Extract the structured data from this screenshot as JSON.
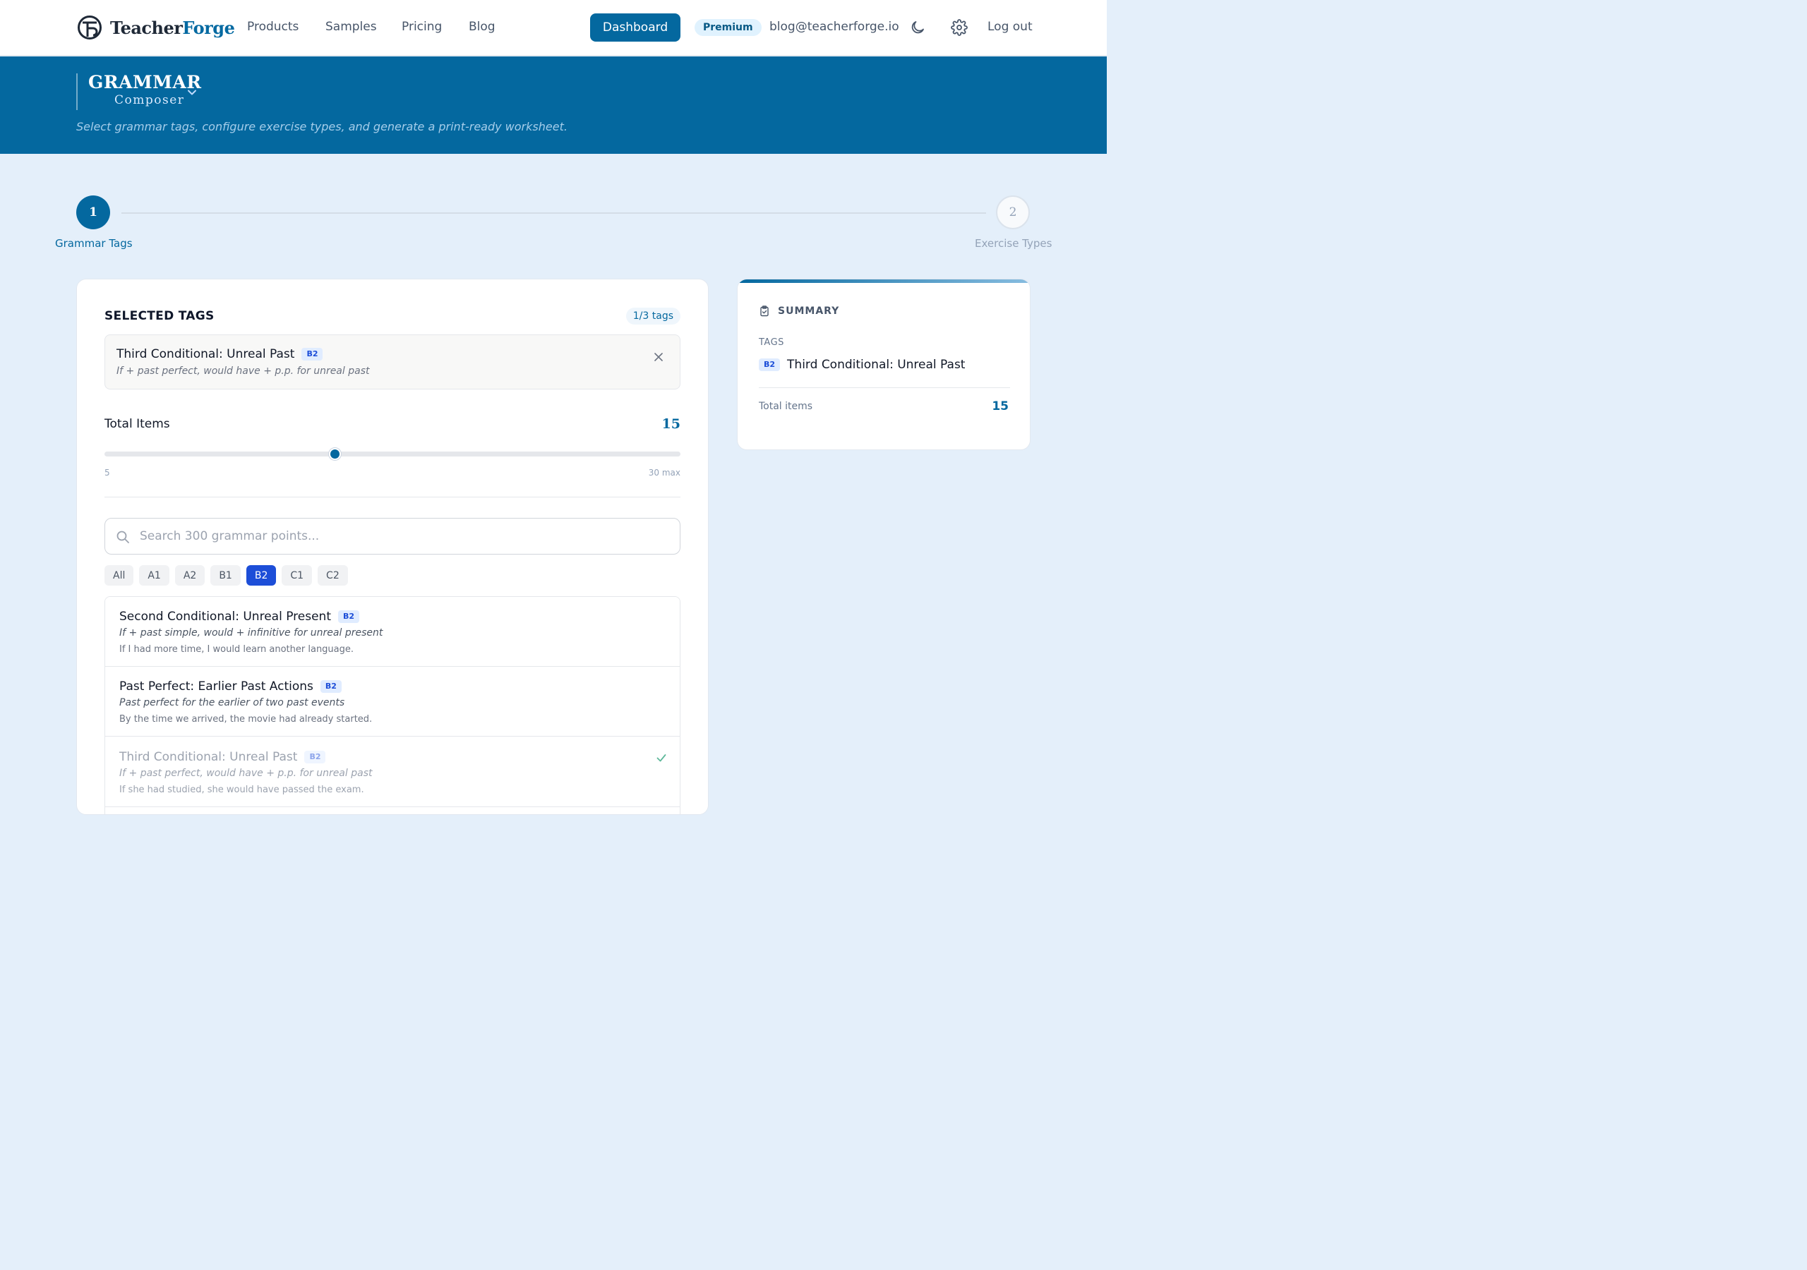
{
  "nav": {
    "brand_part1": "Teacher",
    "brand_part2": "Forge",
    "links": [
      "Products",
      "Samples",
      "Pricing",
      "Blog"
    ],
    "dashboard_label": "Dashboard",
    "premium_label": "Premium",
    "email": "blog@teacherforge.io",
    "logout_label": "Log out",
    "icons": [
      "teacherforge-logo",
      "moon-icon",
      "gear-icon"
    ]
  },
  "hero": {
    "title": "GRAMMAR",
    "subtitle": "Composer",
    "description": "Select grammar tags, configure exercise types, and generate a print-ready worksheet."
  },
  "stepper": {
    "steps": [
      {
        "number": "1",
        "label": "Grammar Tags",
        "active": true
      },
      {
        "number": "2",
        "label": "Exercise Types",
        "active": false
      }
    ]
  },
  "selected": {
    "title": "SELECTED TAGS",
    "count": "1/3 tags",
    "tags": [
      {
        "name": "Third Conditional: Unreal Past",
        "level": "B2",
        "description": "If + past perfect, would have + p.p. for unreal past"
      }
    ]
  },
  "items": {
    "label": "Total Items",
    "value": "15",
    "min_label": "5",
    "max_label": "30 max",
    "min": 5,
    "max": 30,
    "current": 15
  },
  "search": {
    "placeholder": "Search 300 grammar points...",
    "value": ""
  },
  "filters": {
    "options": [
      "All",
      "A1",
      "A2",
      "B1",
      "B2",
      "C1",
      "C2"
    ],
    "selected": "B2"
  },
  "grammar_list": [
    {
      "name": "Second Conditional: Unreal Present",
      "level": "B2",
      "description": "If + past simple, would + infinitive for unreal present",
      "example": "If I had more time, I would learn another language.",
      "selected": false
    },
    {
      "name": "Past Perfect: Earlier Past Actions",
      "level": "B2",
      "description": "Past perfect for the earlier of two past events",
      "example": "By the time we arrived, the movie had already started.",
      "selected": false
    },
    {
      "name": "Third Conditional: Unreal Past",
      "level": "B2",
      "description": "If + past perfect, would have + p.p. for unreal past",
      "example": "If she had studied, she would have passed the exam.",
      "selected": true
    }
  ],
  "summary": {
    "title": "SUMMARY",
    "tags_label": "TAGS",
    "tags": [
      {
        "level": "B2",
        "name": "Third Conditional: Unreal Past"
      }
    ],
    "total_label": "Total items",
    "total_value": "15"
  },
  "colors": {
    "primary": "#04689f",
    "level_badge_bg": "#e0ecff",
    "level_badge_text": "#1d4ed8",
    "page_bg": "#e4effa"
  }
}
